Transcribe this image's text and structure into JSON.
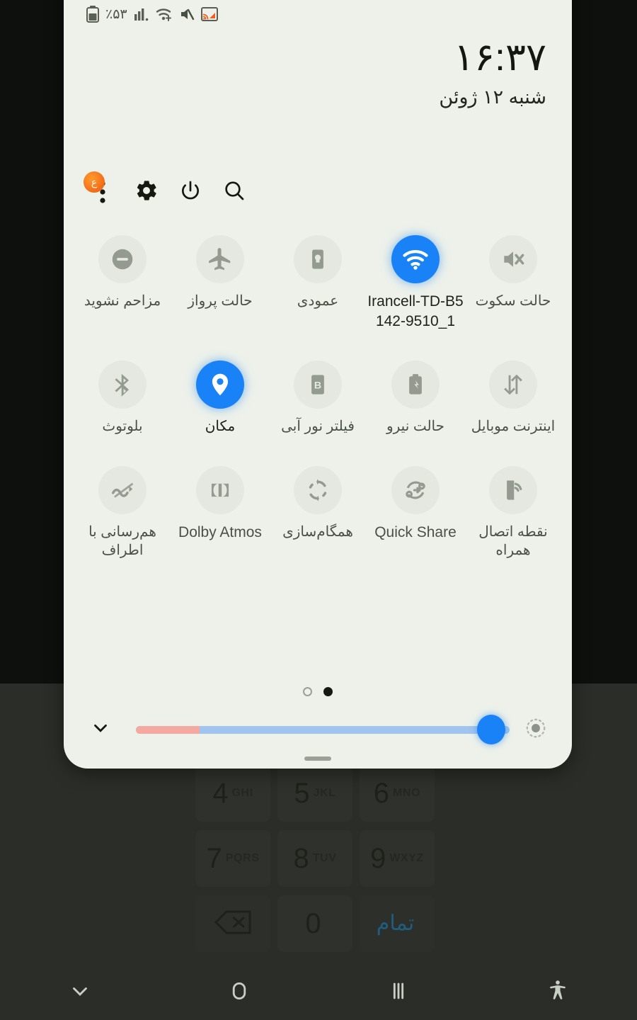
{
  "status_bar": {
    "battery_percent": "٪۵۳",
    "icons": [
      "battery-icon",
      "signal-bars-icon",
      "wifi-icon",
      "mute-icon",
      "cast-icon"
    ]
  },
  "clock": {
    "time": "۱۶:۳۷",
    "date": "شنبه ۱۲ ژوئن"
  },
  "toolbar": {
    "menu_badge": "ع",
    "buttons": [
      {
        "name": "more-options-button",
        "icon": "three-dots-icon"
      },
      {
        "name": "settings-button",
        "icon": "gear-icon"
      },
      {
        "name": "power-button",
        "icon": "power-icon"
      },
      {
        "name": "search-button",
        "icon": "search-icon"
      }
    ]
  },
  "tiles": [
    {
      "label": "مزاحم نشوید",
      "icon": "do-not-disturb-icon",
      "state": "off",
      "name": "tile-do-not-disturb"
    },
    {
      "label": "حالت پرواز",
      "icon": "airplane-icon",
      "state": "off",
      "name": "tile-airplane-mode"
    },
    {
      "label": "عمودی",
      "icon": "rotation-lock-icon",
      "state": "off",
      "name": "tile-auto-rotate"
    },
    {
      "label": "Irancell-TD-B5 142-9510_1",
      "icon": "wifi-icon",
      "state": "on",
      "name": "tile-wifi"
    },
    {
      "label": "حالت سکوت",
      "icon": "mute-icon",
      "state": "off",
      "name": "tile-mute"
    },
    {
      "label": "بلوتوث",
      "icon": "bluetooth-icon",
      "state": "off",
      "name": "tile-bluetooth"
    },
    {
      "label": "مکان",
      "icon": "location-pin-icon",
      "state": "on",
      "name": "tile-location"
    },
    {
      "label": "فیلتر نور آبی",
      "icon": "blue-light-filter-icon",
      "state": "off",
      "name": "tile-blue-light-filter"
    },
    {
      "label": "حالت نیرو",
      "icon": "power-mode-icon",
      "state": "off",
      "name": "tile-power-mode"
    },
    {
      "label": "اینترنت موبایل",
      "icon": "mobile-data-icon",
      "state": "off",
      "name": "tile-mobile-data"
    },
    {
      "label": "هم‌رسانی با اطراف",
      "icon": "nearby-share-icon",
      "state": "off",
      "name": "tile-nearby-share"
    },
    {
      "label": "Dolby Atmos",
      "icon": "dolby-atmos-icon",
      "state": "off",
      "name": "tile-dolby-atmos"
    },
    {
      "label": "همگام‌سازی",
      "icon": "sync-icon",
      "state": "off",
      "name": "tile-sync"
    },
    {
      "label": "Quick Share",
      "icon": "quick-share-icon",
      "state": "off",
      "name": "tile-quick-share"
    },
    {
      "label": "نقطه اتصال همراه",
      "icon": "mobile-hotspot-icon",
      "state": "off",
      "name": "tile-mobile-hotspot"
    }
  ],
  "pager": {
    "pages": 2,
    "active_index": 1
  },
  "brightness": {
    "value_percent": 95,
    "collapse_icon": "chevron-down-icon",
    "auto_icon": "auto-brightness-icon"
  },
  "dialpad": {
    "keys": [
      {
        "num": "4",
        "sub": "GHI"
      },
      {
        "num": "5",
        "sub": "JKL"
      },
      {
        "num": "6",
        "sub": "MNO"
      },
      {
        "num": "7",
        "sub": "PQRS"
      },
      {
        "num": "8",
        "sub": "TUV"
      },
      {
        "num": "9",
        "sub": "WXYZ"
      },
      {
        "num": "",
        "sub": "",
        "icon": "backspace-icon"
      },
      {
        "num": "0",
        "sub": ""
      },
      {
        "num": "تمام",
        "sub": ""
      }
    ]
  },
  "navbar": {
    "buttons": [
      {
        "name": "nav-back-button",
        "icon": "chevron-down-icon"
      },
      {
        "name": "nav-home-button",
        "icon": "home-circle-icon"
      },
      {
        "name": "nav-recents-button",
        "icon": "recents-icon"
      },
      {
        "name": "nav-accessibility-button",
        "icon": "accessibility-icon"
      }
    ]
  },
  "colors": {
    "accent_blue": "#1a82f7",
    "panel_bg": "#edf1ea",
    "badge_orange": "#f4701a",
    "slider_low": "#f3a9a0",
    "done_blue": "#1d6f9e"
  }
}
